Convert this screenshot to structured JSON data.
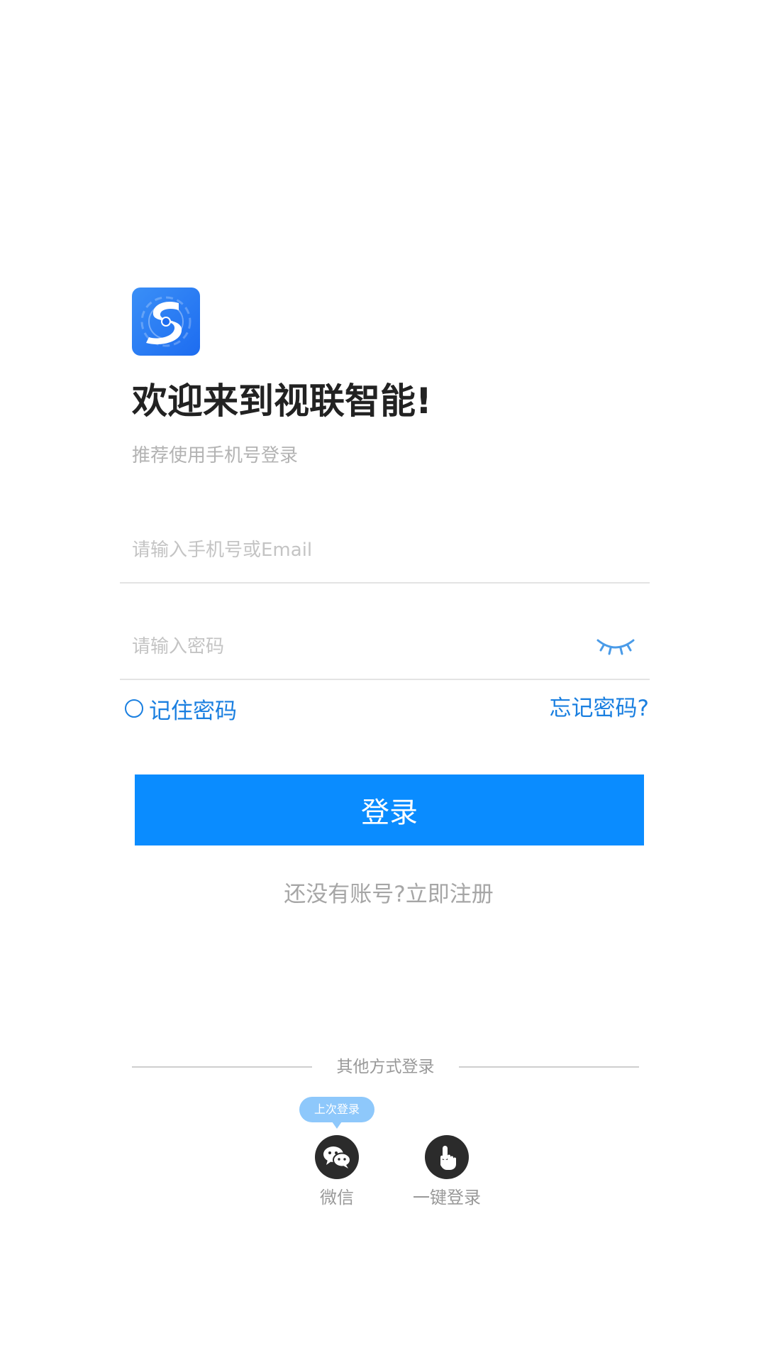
{
  "header": {
    "logo_icon": "app-logo-s-icon",
    "welcome": "欢迎来到视联智能!",
    "subtitle": "推荐使用手机号登录"
  },
  "form": {
    "account_placeholder": "请输入手机号或Email",
    "password_placeholder": "请输入密码",
    "remember_label": "记住密码",
    "forgot_label": "忘记密码?",
    "login_label": "登录",
    "register_label": "还没有账号?立即注册"
  },
  "other_login": {
    "title": "其他方式登录",
    "last_badge": "上次登录",
    "wechat_label": "微信",
    "onekey_label": "一键登录"
  },
  "colors": {
    "primary": "#0a8cff",
    "link": "#1a7fe0",
    "badge": "#8ec8fb"
  }
}
